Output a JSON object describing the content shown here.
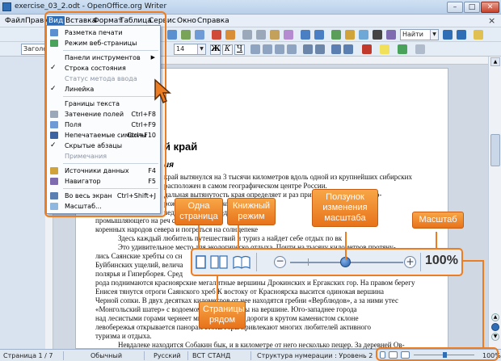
{
  "window": {
    "title": "exercise_03_2.odt - OpenOffice.org Writer",
    "min": "–",
    "max": "□",
    "close": "✕"
  },
  "menubar": [
    "Файл",
    "Правка",
    "Вид",
    "Вставка",
    "Формат",
    "Таблица",
    "Сервис",
    "Окно",
    "Справка"
  ],
  "toolbar": {
    "style_value": "Заголо",
    "font_size_value": "14",
    "bold": "Ж",
    "italic": "К",
    "underline": "Ч",
    "find_value": "Найти"
  },
  "view_menu": [
    {
      "label": "Разметка печати",
      "shortcut": "",
      "enabled": true,
      "icon": "page-layout-icon"
    },
    {
      "label": "Режим веб-страницы",
      "shortcut": "",
      "enabled": true,
      "icon": "web-layout-icon"
    },
    {
      "sep": true
    },
    {
      "label": "Панели инструментов",
      "shortcut": "",
      "enabled": true,
      "submenu": true
    },
    {
      "label": "Строка состояния",
      "shortcut": "",
      "enabled": true,
      "checked": true
    },
    {
      "label": "Статус метода ввода",
      "shortcut": "",
      "enabled": false
    },
    {
      "label": "Линейка",
      "shortcut": "",
      "enabled": true,
      "checked": true
    },
    {
      "sep": true
    },
    {
      "label": "Границы текста",
      "shortcut": "",
      "enabled": true
    },
    {
      "label": "Затенение полей",
      "shortcut": "Ctrl+F8",
      "enabled": true,
      "icon": "field-shading-icon"
    },
    {
      "label": "Поля",
      "shortcut": "Ctrl+F9",
      "enabled": true,
      "icon": "fields-icon"
    },
    {
      "label": "Непечатаемые символы",
      "shortcut": "Ctrl+F10",
      "enabled": true,
      "icon": "formatting-marks-icon"
    },
    {
      "label": "Скрытые абзацы",
      "shortcut": "",
      "enabled": true,
      "checked": true
    },
    {
      "label": "Примечания",
      "shortcut": "",
      "enabled": false
    },
    {
      "sep": true
    },
    {
      "label": "Источники данных",
      "shortcut": "F4",
      "enabled": true,
      "icon": "data-sources-icon"
    },
    {
      "label": "Навигатор",
      "shortcut": "F5",
      "enabled": true,
      "icon": "navigator-icon"
    },
    {
      "sep": true
    },
    {
      "label": "Во весь экран",
      "shortcut": "Ctrl+Shift+J",
      "enabled": true,
      "icon": "fullscreen-icon"
    },
    {
      "label": "Масштаб...",
      "shortcut": "",
      "enabled": true,
      "icon": "zoom-icon"
    }
  ],
  "document": {
    "heading": "й край",
    "subheading": "ия",
    "lines": [
      "край вытянулся на 3 тысячи километров вдоль одной из крупнейших сибирских",
      "расположен в самом географическом центре России.",
      "дальная вытянутость края определяет и раз                     природных зон на его тер-",
      "                                           рожно всего за несколько дней уви-",
      "                                                                  ведь увидеть медведя,",
      "промышляющего на реч                                                  сится с бытом",
      "коренных народов севера и погреться на солнцепеке",
      "Здесь каждый любитель путешествий и туриз а найдет себе отдых по вк",
      "Это удивительное место для экологическо отдыха. Почти на тысячу   километров протяну-",
      "лись Саянские хребты со сн",
      "Буйбинских ущелий, велича",
      "полярья и Гиперборея. Сред",
      "рода поднимаются красноярские мегалитные вершины Дрокинских и Ергакских гор. На правом берегу",
      "Енисея тянутся отроги Саянского хреб   К востоку от Красноярска высится одинокая вершина",
      "Черной сопки. В двух десятках километров от нее находятся гребни «Верблюдов», а за ними утес",
      "«Монгольский шатер» с водоемом         ровой глубины на вершине. Юго-западнее города",
      "над лесистыми горами чернеет мн          С шоссейной дороги в крутом каменистом склоне",
      "левобережья открывается панорам         стоты горы привлекают многих любителей активного",
      "туризма и отдыха.",
      "Невдалеке находится Собакин бык, и в километре от него несколько пещер. За деревней Ов-"
    ]
  },
  "statusbar": {
    "page": "Страница  1 / 7",
    "style": "Обычный",
    "language": "Русский",
    "insert": "ВСТ",
    "selection": "СТАНД",
    "outline": "Структура нумерации : Уровень  2",
    "zoom": "100%"
  },
  "zoom_panel": {
    "minus": "−",
    "plus": "+",
    "zoom": "100%",
    "level_percent": 100
  },
  "callouts": {
    "one_page": "Одна\nстраница",
    "book_mode": "Книжный\nрежим",
    "zoom_slider": "Ползунок\nизменения\nмасштаба",
    "zoom": "Масштаб",
    "pages_side": "Страницы\nрядом"
  },
  "colors": {
    "accent": "#ec7d22",
    "menu_highlight": "#2f6db5"
  }
}
